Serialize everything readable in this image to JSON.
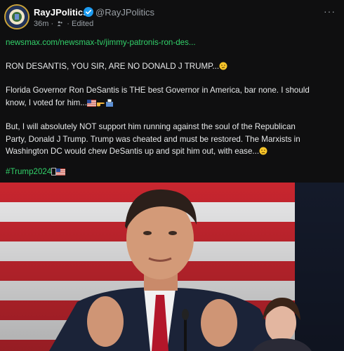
{
  "post": {
    "author_name": "RayJPolitics",
    "author_handle": "@RayJPolitics",
    "time_ago": "36m",
    "meta_separator": "·",
    "edited_label": "Edited",
    "more_label": "···",
    "link_text": "newsmax.com/newsmax-tv/jimmy-patronis-ron-des...",
    "headline": "RON DESANTIS, YOU SIR, ARE NO DONALD J TRUMP...",
    "para1_line1": "Florida Governor Ron DeSantis is THE best Governor in America, bar none. I should",
    "para1_line2": "know, I voted for him...",
    "para2_line1": "But, I will absolutely NOT support him running against the soul of the Republican",
    "para2_line2": "Party, Donald J Trump. Trump was cheated and must be restored. The Marxists in",
    "para2_line3": "Washington DC would chew DeSantis up and spit him out, with ease...",
    "hashtag": "#Trump2024"
  },
  "icons": {
    "verified": "verified-badge-icon",
    "audience": "people-icon",
    "more": "more-options-icon",
    "emojis": [
      "thinking-face",
      "us-flag",
      "pointing-hand",
      "ballot-box",
      "slightly-frowning-face"
    ]
  },
  "colors": {
    "background": "#0f0f10",
    "link": "#32d16a",
    "verified": "#1d9bf0",
    "muted": "#9aa0a6"
  }
}
